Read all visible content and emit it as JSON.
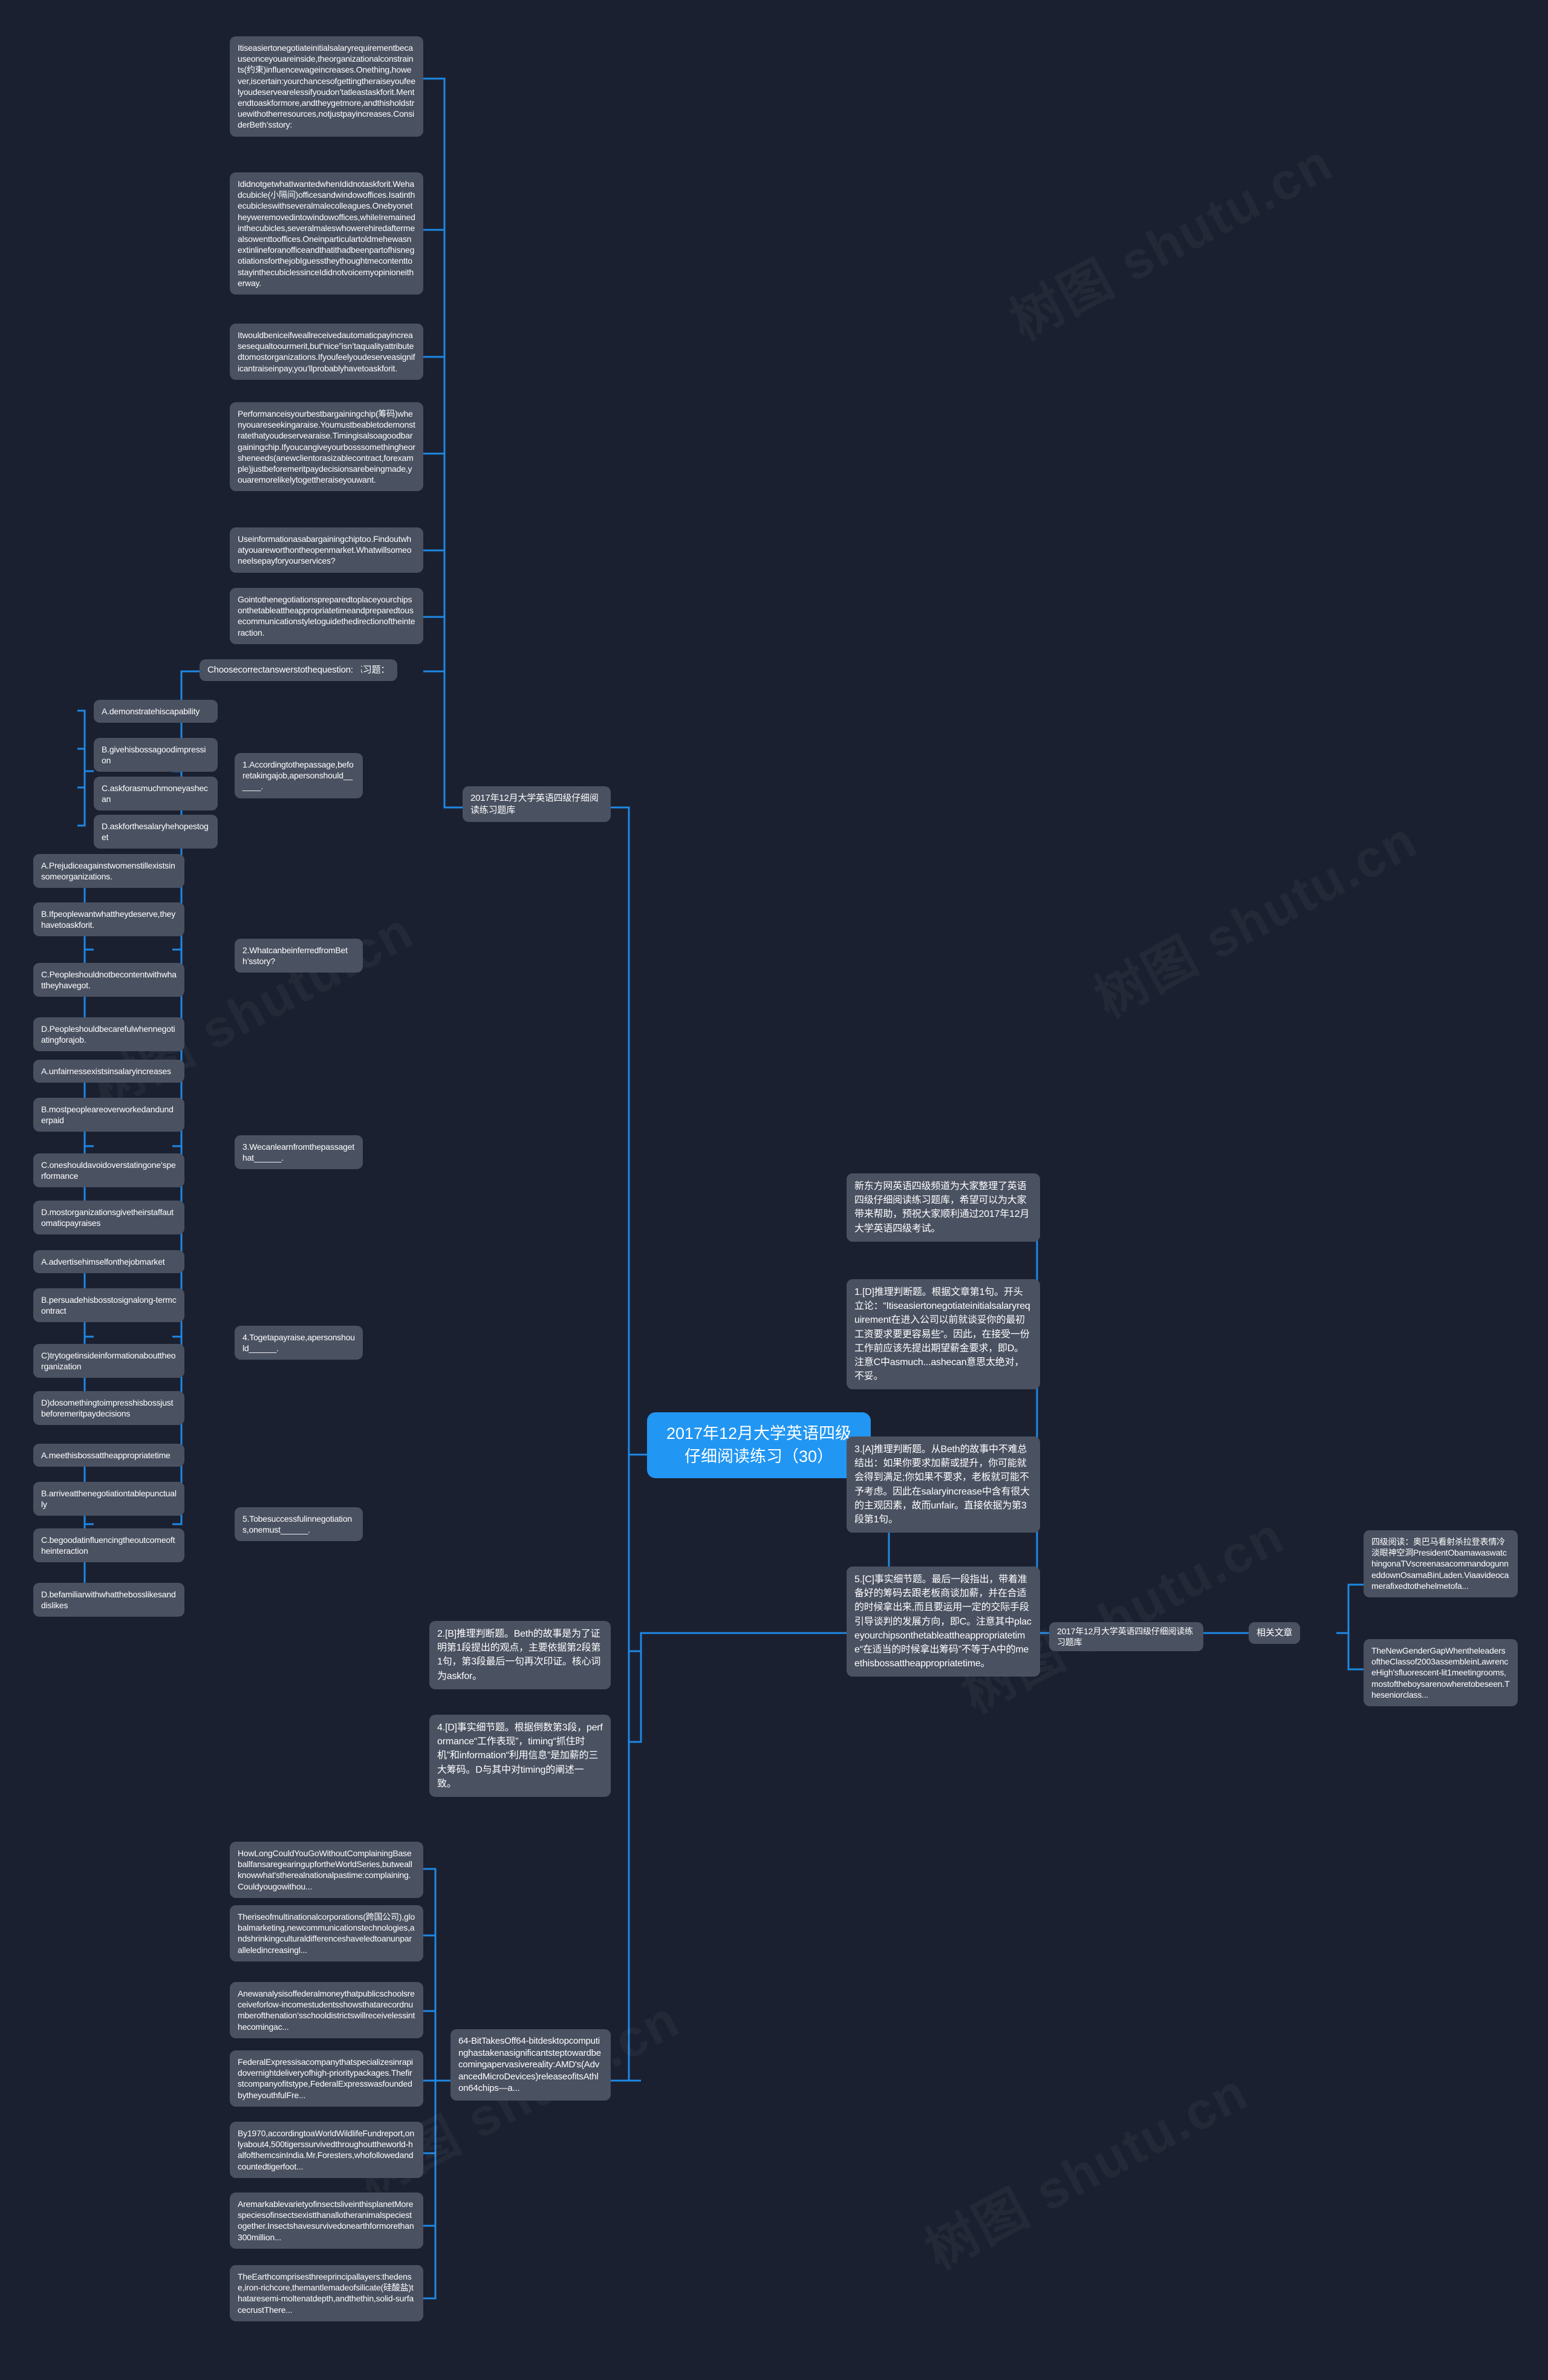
{
  "root": {
    "label": "2017年12月大学英语四级仔细阅读练习（30）"
  },
  "branches": {
    "exercise_title": "2017年12月大学英语四级仔细阅读练习题库",
    "answer_key_title": "2017年12月大学英语四级仔细阅读练习题库",
    "related_title": "相关文章",
    "practice_label": "练习题：",
    "instruction": "Choosecorrectanswerstothequestion:"
  },
  "passage": [
    "Itiseasiertonegotiateinitialsalaryrequirementbecauseonceyouareinside,theorganizationalconstraints(约束)influencewageincreases.Onething,however,iscertain:yourchancesofgettingtheraiseyoufeelyoudeservearelessifyoudon’tatleastaskforit.Mentendtoaskformore,andtheygetmore,andthisholdstruewithotherresources,notjustpayincreases.ConsiderBeth’sstory:",
    "IdidnotgetwhatIwantedwhenIdidnotaskforit.Wehadcubicle(小隔间)officesandwindowoffices.Isatinthecubicleswithseveralmalecolleagues.Onebyonetheyweremovedintowindowoffices,whileIremainedinthecubicles,severalmaleswhowerehiredaftermealsowenttooffices.OneinparticulartoldmehewasnextinlineforanofficeandthatithadbeenpartofhisnegotiationsforthejobIguesstheythoughtmecontenttostayinthecubiclessinceIdidnotvoicemyopinioneitherway.",
    "Itwouldbeniceifweallreceivedautomaticpayincreasesequaltoourmerit,but“nice”isn’taqualityattributedtomostorganizations.Ifyoufeelyoudeserveasignificantraiseinpay,you’llprobablyhavetoaskforit.",
    "Performanceisyourbestbargainingchip(筹码)whenyouareseekingaraise.Youmustbeabletodemonstratethatyoudeservearaise.Timingisalsoagoodbargainingchip.Ifyoucangiveyourbosssomethingheorsheneeds(anewclientorasizablecontract,forexample)justbeforemeritpaydecisionsarebeingmade,youaremorelikelytogettheraiseyouwant.",
    "Useinformationasabargainingchiptoo.Findoutwhatyouareworthontheopenmarket.Whatwillsomeoneelsepayforyourservices?",
    "Gointothenegotiationspreparedtoplaceyourchipsonthetableattheappropriatetimeandpreparedtousecommunicationstyletoguidethedirectionoftheinteraction."
  ],
  "questions": [
    {
      "stem": "1.Accordingtothepassage,beforetakingajob,apersonshould______.",
      "options": [
        "A.demonstratehiscapability",
        "B.givehisbossagoodimpression",
        "C.askforasmuchmoneyashecan",
        "D.askforthesalaryhehopestoget"
      ]
    },
    {
      "stem": "2.WhatcanbeinferredfromBeth’sstory?",
      "options": [
        "A.Prejudiceagainstwomenstillexistsinsomeorganizations.",
        "B.Ifpeoplewantwhattheydeserve,theyhavetoaskforit.",
        "C.Peopleshouldnotbecontentwithwhattheyhavegot.",
        "D.Peopleshouldbecarefulwhennegotiatingforajob."
      ]
    },
    {
      "stem": "3.Wecanlearnfromthepassagethat______.",
      "options": [
        "A.unfairnessexistsinsalaryincreases",
        "B.mostpeopleareoverworkedandunderpaid",
        "C.oneshouldavoidoverstatingone’sperformance",
        "D.mostorganizationsgivetheirstaffautomaticpayraises"
      ]
    },
    {
      "stem": "4.Togetapayraise,apersonshould______.",
      "options": [
        "A.advertisehimselfonthejobmarket",
        "B.persuadehisbosstosignalong-termcontract",
        "C)trytogetinsideinformationabouttheorganization",
        "D)dosomethingtoimpresshisbossjustbeforemeritpaydecisions"
      ]
    },
    {
      "stem": "5.Tobesuccessfulinnegotiations,onemust______.",
      "options": [
        "A.meethisbossattheappropriatetime",
        "B.arriveatthenegotiationtablepunctually",
        "C.begoodatinfluencingtheoutcomeoftheinteraction",
        "D.befamiliarwithwhatthebosslikesanddislikes"
      ]
    }
  ],
  "answers": {
    "intro": "新东方网英语四级频道为大家整理了英语四级仔细阅读练习题库，希望可以为大家带来帮助，预祝大家顺利通过2017年12月大学英语四级考试。",
    "a1": "1.[D]推理判断题。根据文章第1句。开头立论：“Itiseasiertonegotiateinitialsalaryrequirement在进入公司以前就谈妥你的最初工资要求要更容易些”。因此，在接受一份工作前应该先提出期望薪金要求，即D。注意C中asmuch...ashecan意思太绝对，不妥。",
    "a2": "2.[B]推理判断题。Beth的故事是为了证明第1段提出的观点，主要依据第2段第1句，第3段最后一句再次印证。核心词为askfor。",
    "a3": "3.[A]推理判断题。从Beth的故事中不难总结出：如果你要求加薪或提升，你可能就会得到满足;你如果不要求，老板就可能不予考虑。因此在salaryincrease中含有很大的主观因素，故而unfair。直接依据为第3段第1句。",
    "a4": "4.[D]事实细节题。根据倒数第3段，performance“工作表现”，timing“抓住时机”和information“利用信息”是加薪的三大筹码。D与其中对timing的阐述一致。",
    "a5": "5.[C]事实细节题。最后一段指出，带着准备好的筹码去跟老板商谈加薪，并在合适的时候拿出来,而且要运用一定的交际手段引导谈判的发展方向，即C。注意其中placeyourchipsonthetableattheappropriatetime“在适当的时候拿出筹码”不等于A中的meethisbossattheappropriatetime。"
  },
  "article_list": [
    "HowLongCouldYouGoWithoutComplainingBaseballfansaregearingupfortheWorldSeries,butweallknowwhat'stherealnationalpastime:complaining.Couldyougowithou...",
    "Theriseofmultinationalcorporations(跨国公司),globalmarketing,newcommunicationstechnologies,andshrinkingculturaldifferenceshaveledtoanunparalleledincreasingl...",
    "Anewanalysisoffederalmoneythatpublicschoolsreceiveforlow-incomestudentsshowsthatarecordnumberofthenation’sschooldistrictswillreceivelessinthecomingac...",
    "FederalExpressisacompanythatspecializesinrapidovernightdeliveryofhigh-prioritypackages.Thefirstcompanyofitstype,FederalExpresswasfoundedbytheyouthfulFre...",
    "By1970,accordingtoaWorldWildlifeFundreport,onlyabout4,500tigerssurvivedthroughouttheworld-halfofthemcsinIndia.Mr.Foresters,whofollowedandcountedtigerfoot...",
    "AremarkablevarietyofinsectsliveinthisplanetMorespeciesofinsectsexistthanallotheranimalspeciestogether.Insectshavesurvivedonearthformorethan300million...",
    "TheEarthcomprisesthreeprincipallayers:thedense,iron-richcore,themantlemadeofsilicate(硅酸盐)thataresemi-moltenatdepth,andthethin,solid-surfacecrustThere...",
    "64-BitTakesOff64-bitdesktopcomputinghastakenasignificantsteptowardbecomingapervasivereality:AMD's(AdvancedMicroDevices)releaseofitsAthlon64chips—a..."
  ],
  "related_articles": [
    "四级阅读：奥巴马看射杀拉登表情冷淡眼神空洞PresidentObamawaswatchingonaTVscreenasacommandogunneddownOsamaBinLaden.Viaavideocamerafixedtothehelmetofa...",
    "TheNewGenderGapWhentheleadersoftheClassof2003assembleinLawrenceHigh'sfluorescent-lit1meetingrooms,mostoftheboysarenowheretobeseen.Theseniorclass..."
  ],
  "colors": {
    "background": "#1b2030",
    "node": "#4a5161",
    "root": "#2196f3",
    "link": "#1e88e5"
  },
  "watermark": "树图 shutu.cn"
}
